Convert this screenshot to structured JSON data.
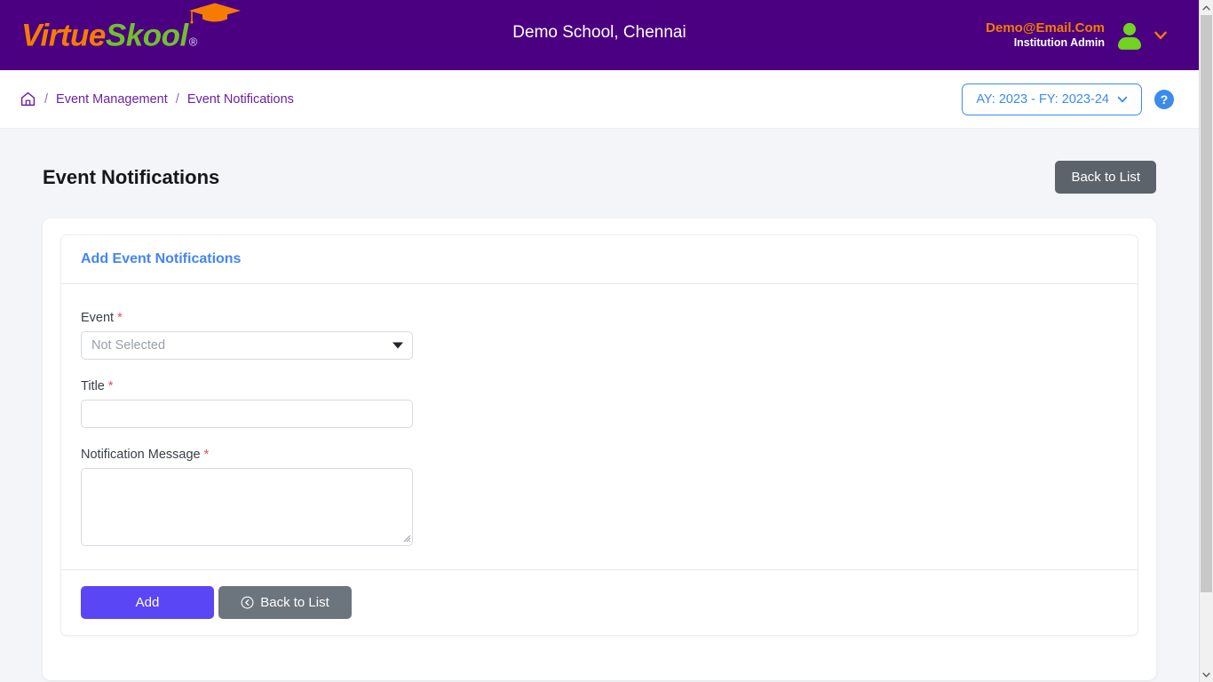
{
  "header": {
    "logo": {
      "part1": "Virtue",
      "part2": "Skool",
      "registered": "®",
      "cap_icon": "graduation-cap-icon"
    },
    "school_title": "Demo School, Chennai",
    "user": {
      "email": "Demo@Email.Com",
      "role": "Institution Admin",
      "avatar_icon": "user-avatar-icon",
      "caret_icon": "chevron-down-icon"
    },
    "colors": {
      "bar": "#4a0080",
      "email": "#f57c00",
      "logo_orange": "#f57c00",
      "logo_green": "#72bf2e"
    }
  },
  "breadcrumb": {
    "home_icon": "home-icon",
    "separator": "/",
    "items": [
      {
        "label": "Event Management"
      },
      {
        "label": "Event Notifications"
      }
    ],
    "academic_year": {
      "label": "AY: 2023 - FY: 2023-24",
      "caret_icon": "chevron-down-icon"
    },
    "help": {
      "label": "?",
      "icon": "help-circle-icon",
      "color": "#3b8beb"
    }
  },
  "page": {
    "title": "Event Notifications",
    "back_to_list_top": "Back to List"
  },
  "card": {
    "title": "Add Event Notifications",
    "title_color": "#4285f4",
    "fields": {
      "event": {
        "label": "Event",
        "required": "*",
        "value": "",
        "placeholder": "Not Selected",
        "caret_icon": "caret-down-icon"
      },
      "title": {
        "label": "Title",
        "required": "*",
        "value": "",
        "placeholder": ""
      },
      "message": {
        "label": "Notification Message",
        "required": "*",
        "value": "",
        "placeholder": ""
      }
    },
    "actions": {
      "add": "Add",
      "back": "Back to List",
      "back_icon": "circle-chevron-left-icon",
      "add_color": "#5a46f5",
      "back_color": "#6c757d"
    }
  },
  "scrollbar": {
    "up_icon": "chevron-up-icon",
    "down_icon": "chevron-down-icon"
  }
}
